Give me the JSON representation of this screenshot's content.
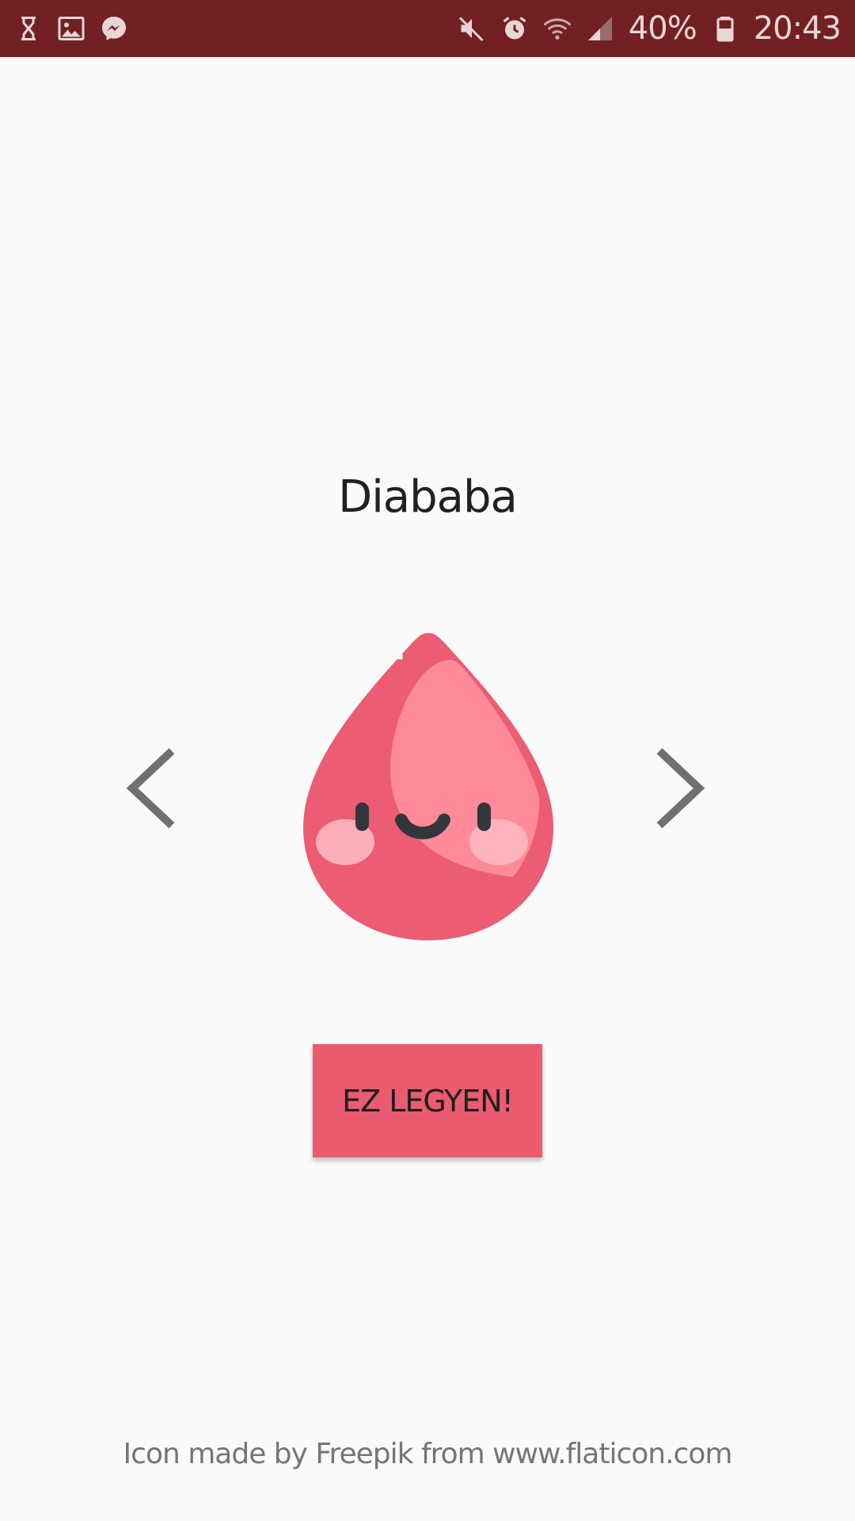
{
  "status_bar": {
    "left_icons": [
      "hourglass-icon",
      "gallery-icon",
      "messenger-icon"
    ],
    "right_icons": [
      "mute-icon",
      "alarm-icon",
      "wifi-icon",
      "signal-icon",
      "battery-icon"
    ],
    "battery_percent": "40%",
    "time": "20:43",
    "background_color": "#722023"
  },
  "main": {
    "title": "Diababa",
    "mascot_icon": "blood-drop-mascot-icon",
    "prev_icon": "chevron-left-icon",
    "next_icon": "chevron-right-icon",
    "select_button_label": "EZ LEGYEN!",
    "button_color": "#ea5b70"
  },
  "footer": {
    "attribution": "Icon made by Freepik from www.flaticon.com"
  }
}
